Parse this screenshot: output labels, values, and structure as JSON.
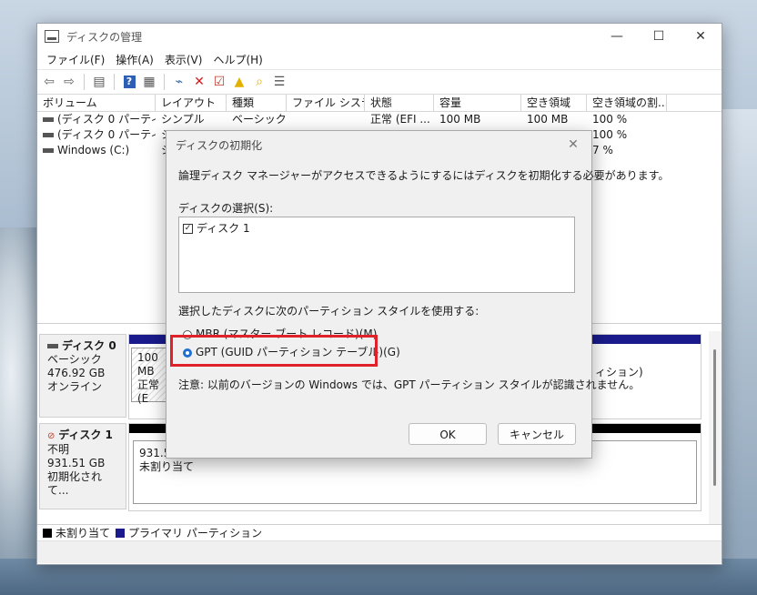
{
  "window": {
    "title": "ディスクの管理",
    "minimize": "—",
    "maximize": "☐",
    "close": "✕"
  },
  "menu": [
    "ファイル(F)",
    "操作(A)",
    "表示(V)",
    "ヘルプ(H)"
  ],
  "volume_table": {
    "headers": [
      "ボリューム",
      "レイアウト",
      "種類",
      "ファイル システム",
      "状態",
      "容量",
      "空き領域",
      "空き領域の割..."
    ],
    "rows": [
      [
        "(ディスク 0 パーティシ...",
        "シンプル",
        "ベーシック",
        "",
        "正常 (EFI ...",
        "100 MB",
        "100 MB",
        "100 %"
      ],
      [
        "(ディスク 0 パーティシ...",
        "シ",
        "",
        "",
        "",
        "",
        "",
        "100 %"
      ],
      [
        "Windows (C:)",
        "シ",
        "",
        "",
        "",
        "",
        "",
        "7 %"
      ]
    ]
  },
  "disks": {
    "disk0": {
      "name": "ディスク 0",
      "type": "ベーシック",
      "size": "476.92 GB",
      "status": "オンライン",
      "part_size": "100 MB",
      "part_status": "正常 (E",
      "part_right": "ィション)"
    },
    "disk1": {
      "name": "ディスク 1",
      "type": "不明",
      "size": "931.51 GB",
      "status": "初期化されて...",
      "part_size": "931.51 GB",
      "part_status": "未割り当て"
    }
  },
  "legend": {
    "unallocated": "未割り当て",
    "primary": "プライマリ パーティション"
  },
  "colors": {
    "primary": "#1a1a8c",
    "unallocated": "#000000",
    "highlight": "#e0212a",
    "radio_accent": "#1f6fd2"
  },
  "dialog": {
    "title": "ディスクの初期化",
    "close": "✕",
    "intro": "論理ディスク マネージャーがアクセスできるようにするにはディスクを初期化する必要があります。",
    "select_label": "ディスクの選択(S):",
    "disk_item": "ディスク 1",
    "style_label": "選択したディスクに次のパーティション スタイルを使用する:",
    "mbr": "MBR (マスター ブート レコード)(M)",
    "gpt": "GPT (GUID パーティション テーブル)(G)",
    "note": "注意: 以前のバージョンの Windows では、GPT パーティション スタイルが認識されません。",
    "ok": "OK",
    "cancel": "キャンセル"
  }
}
